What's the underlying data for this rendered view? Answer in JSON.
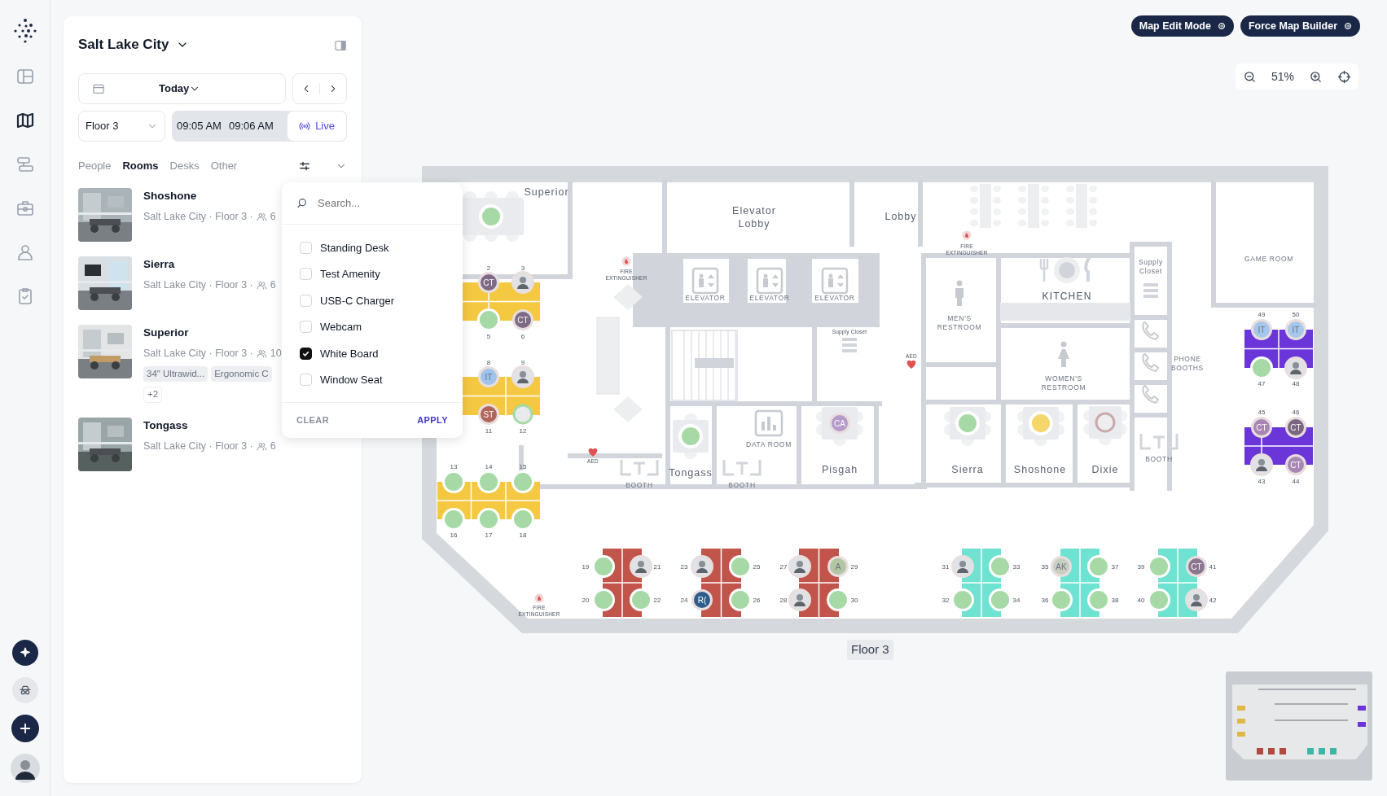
{
  "rail": {
    "items": [
      {
        "selected": false
      },
      {
        "selected": true
      },
      {
        "selected": false
      },
      {
        "selected": false
      },
      {
        "selected": false
      },
      {
        "selected": false
      }
    ]
  },
  "panel": {
    "location": "Salt Lake City",
    "date": "Today",
    "floor": "Floor 3",
    "time_start": "09:05 AM",
    "time_end": "09:06 AM",
    "live": "Live",
    "tabs": [
      {
        "label": "People",
        "selected": false
      },
      {
        "label": "Rooms",
        "selected": true
      },
      {
        "label": "Desks",
        "selected": false
      },
      {
        "label": "Other",
        "selected": false
      }
    ],
    "rooms": [
      {
        "name": "Shoshone",
        "meta": "Salt Lake City · Floor 3 ·",
        "capacity": "6"
      },
      {
        "name": "Sierra",
        "meta": "Salt Lake City · Floor 3 ·",
        "capacity": "6"
      },
      {
        "name": "Superior",
        "meta": "Salt Lake City · Floor 3 ·",
        "capacity": "10",
        "amenities": [
          "34\" Ultrawid...",
          "Ergonomic C"
        ],
        "more": "+2"
      },
      {
        "name": "Tongass",
        "meta": "Salt Lake City · Floor 3 ·",
        "capacity": "6"
      }
    ]
  },
  "filter_menu": {
    "placeholder": "Search...",
    "options": [
      {
        "label": "Standing Desk",
        "checked": false
      },
      {
        "label": "Test Amenity",
        "checked": false
      },
      {
        "label": "USB-C Charger",
        "checked": false
      },
      {
        "label": "Webcam",
        "checked": false
      },
      {
        "label": "White Board",
        "checked": true
      },
      {
        "label": "Window Seat",
        "checked": false
      }
    ],
    "clear": "CLEAR",
    "apply": "APPLY"
  },
  "map_controls": {
    "buttons": [
      "Map Edit Mode",
      "Force Map Builder"
    ],
    "zoom": "51%"
  },
  "map": {
    "labels": [
      {
        "text": "Superior",
        "kind": "room"
      },
      {
        "text": "Elevator Lobby",
        "kind": "room"
      },
      {
        "text": "Lobby",
        "kind": "room"
      },
      {
        "text": "FIRE EXTINGUISHER",
        "kind": "note"
      },
      {
        "text": "FIRE EXTINGUISHER",
        "kind": "note"
      },
      {
        "text": "ELEVATOR",
        "kind": "area"
      },
      {
        "text": "ELEVATOR",
        "kind": "area"
      },
      {
        "text": "ELEVATOR",
        "kind": "area"
      },
      {
        "text": "KITCHEN",
        "kind": "heading"
      },
      {
        "text": "Supply Closet",
        "kind": "area"
      },
      {
        "text": "GAME ROOM",
        "kind": "area"
      },
      {
        "text": "MEN'S RESTROOM",
        "kind": "area"
      },
      {
        "text": "Supply Closet",
        "kind": "note"
      },
      {
        "text": "AED",
        "kind": "note"
      },
      {
        "text": "PHONE BOOTHS",
        "kind": "area"
      },
      {
        "text": "WOMEN'S RESTROOM",
        "kind": "area"
      },
      {
        "text": "BOOTH",
        "kind": "area"
      },
      {
        "text": "DATA ROOM",
        "kind": "area"
      },
      {
        "text": "AED",
        "kind": "note"
      },
      {
        "text": "BOOTH",
        "kind": "area"
      },
      {
        "text": "Tongass",
        "kind": "room"
      },
      {
        "text": "BOOTH",
        "kind": "area"
      },
      {
        "text": "Pisgah",
        "kind": "room"
      },
      {
        "text": "Sierra",
        "kind": "room"
      },
      {
        "text": "Shoshone",
        "kind": "room"
      },
      {
        "text": "Dixie",
        "kind": "room"
      },
      {
        "text": "FIRE EXTINGUISHER",
        "kind": "note"
      }
    ],
    "room_tables": [
      {
        "kind": "available"
      },
      {
        "kind": "available"
      },
      {
        "kind": "occupied",
        "initials": "CA",
        "color": "#b49bc9"
      },
      {
        "kind": "available"
      },
      {
        "kind": "reserved"
      },
      {
        "kind": "vacant"
      }
    ],
    "desk_clusters": [
      {
        "color": "#f5c842",
        "seats": [
          {
            "number": "2",
            "kind": "initials",
            "initials": "CT",
            "color": "#7e6a86"
          },
          {
            "number": "5",
            "kind": "free"
          },
          {
            "number": "3"
          },
          {
            "number": "6",
            "kind": "initials",
            "initials": "CT",
            "color": "#7e6a86"
          }
        ]
      },
      {
        "color": "#f5c842",
        "seats": [
          {
            "number": "8",
            "kind": "initials",
            "initials": "IT",
            "color": "#9fc3ea"
          },
          {
            "number": "9"
          },
          {
            "number": "11",
            "kind": "initials",
            "initials": "ST",
            "color": "#b0645a"
          },
          {
            "number": "12",
            "kind": "open"
          }
        ]
      },
      {
        "color": "#f5c842",
        "seats": [
          {
            "number": "13",
            "kind": "free"
          },
          {
            "number": "14",
            "kind": "free"
          },
          {
            "number": "15",
            "kind": "free"
          },
          {
            "number": "16",
            "kind": "free"
          },
          {
            "number": "17",
            "kind": "free"
          },
          {
            "number": "18",
            "kind": "free"
          }
        ]
      },
      {
        "color": "#c2554b",
        "seats": [
          {
            "number": "19",
            "kind": "free"
          },
          {
            "number": "21"
          },
          {
            "number": "20",
            "kind": "free"
          },
          {
            "number": "22",
            "kind": "free"
          }
        ]
      },
      {
        "color": "#c2554b",
        "seats": [
          {
            "number": "23"
          },
          {
            "number": "25",
            "kind": "free"
          },
          {
            "number": "24",
            "kind": "initials",
            "initials": "R(",
            "color": "#2e5d8c"
          },
          {
            "number": "26",
            "kind": "free"
          }
        ]
      },
      {
        "color": "#c2554b",
        "seats": [
          {
            "number": "27"
          },
          {
            "number": "29",
            "kind": "initials",
            "initials": "A",
            "color": "#b3c6a4"
          },
          {
            "number": "28"
          },
          {
            "number": "30",
            "kind": "free"
          }
        ]
      },
      {
        "color": "#6fe3d1",
        "seats": [
          {
            "number": "31"
          },
          {
            "number": "33",
            "kind": "free"
          },
          {
            "number": "32",
            "kind": "free"
          },
          {
            "number": "34",
            "kind": "free"
          }
        ]
      },
      {
        "color": "#6fe3d1",
        "seats": [
          {
            "number": "35",
            "kind": "initials",
            "initials": "AK",
            "color": "#c9cfc0"
          },
          {
            "number": "37",
            "kind": "free"
          },
          {
            "number": "36",
            "kind": "free"
          },
          {
            "number": "38",
            "kind": "free"
          }
        ]
      },
      {
        "color": "#6fe3d1",
        "seats": [
          {
            "number": "39",
            "kind": "free"
          },
          {
            "number": "41",
            "kind": "initials",
            "initials": "CT",
            "color": "#8a7690"
          },
          {
            "number": "40",
            "kind": "free"
          },
          {
            "number": "42"
          }
        ]
      },
      {
        "color": "#6a36d9",
        "seats": [
          {
            "number": "49",
            "kind": "initials",
            "initials": "IT",
            "color": "#a6c7ec"
          },
          {
            "number": "50",
            "kind": "initials",
            "initials": "IT",
            "color": "#a6c7ec"
          },
          {
            "number": "47",
            "kind": "free"
          },
          {
            "number": "48"
          }
        ]
      },
      {
        "color": "#6a36d9",
        "seats": [
          {
            "number": "45",
            "kind": "initials",
            "initials": "CT",
            "color": "#a987b5"
          },
          {
            "number": "43"
          },
          {
            "number": "46",
            "kind": "initials",
            "initials": "CT",
            "color": "#7b6880"
          },
          {
            "number": "44",
            "kind": "initials",
            "initials": "CT",
            "color": "#a987b5"
          }
        ]
      }
    ],
    "floor_label": "Floor 3"
  }
}
